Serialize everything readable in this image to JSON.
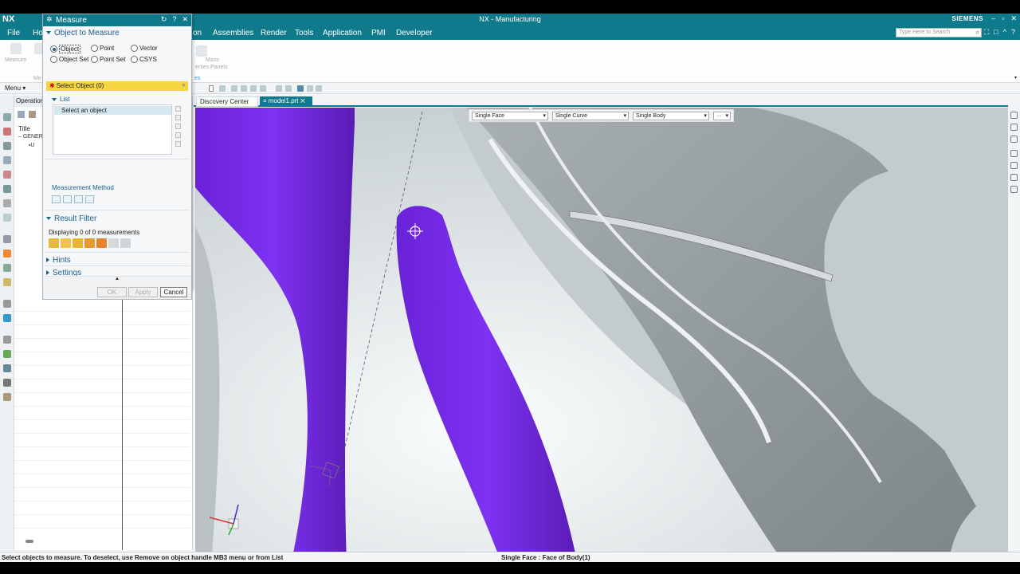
{
  "app": {
    "logo": "NX",
    "window_title": "NX - Manufacturing",
    "brand": "SIEMENS",
    "window_controls": [
      "–",
      "▫",
      "✕"
    ]
  },
  "menubar": {
    "items": [
      "File",
      "Ho",
      "on",
      "Assemblies",
      "Render",
      "Tools",
      "Application",
      "PMI",
      "Developer"
    ],
    "search_placeholder": "Type Here to Search",
    "right_controls": [
      "⛶",
      "□",
      "^",
      "?"
    ]
  },
  "ribbon": {
    "labels": [
      "Measure",
      "Me",
      "Mass",
      "erties Panels",
      "es"
    ]
  },
  "toolbar": {
    "menu_label": "Menu ▾"
  },
  "navigator": {
    "header": "Operation",
    "column_title": "Title",
    "root": "GENER",
    "child": "U"
  },
  "dialog": {
    "title": "Measure",
    "section_object": "Object to Measure",
    "radios": [
      {
        "label": "Object",
        "checked": true
      },
      {
        "label": "Point",
        "checked": false
      },
      {
        "label": "Vector",
        "checked": false
      },
      {
        "label": "Object Set",
        "checked": false
      },
      {
        "label": "Point Set",
        "checked": false
      },
      {
        "label": "CSYS",
        "checked": false
      }
    ],
    "select_object": "Select Object (0)",
    "list_label": "List",
    "list_item": "Select an object",
    "measurement_method": "Measurement Method",
    "section_result": "Result Filter",
    "displaying": "Displaying 0 of 0 measurements",
    "hints": "Hints",
    "settings": "Settings",
    "btn_ok": "OK",
    "btn_apply": "Apply",
    "btn_cancel": "Cancel"
  },
  "tabs": {
    "discovery": "Discovery Center",
    "model": "model1.prt"
  },
  "selection_filter": {
    "face": "Single Face",
    "curve": "Single Curve",
    "body": "Single Body",
    "more": "···"
  },
  "status": {
    "left": "Select objects to measure. To deselect, use Remove on object handle MB3 menu or from List",
    "right": "Single Face : Face of Body(1)"
  },
  "colors": {
    "accent": "#0f7a8c",
    "highlight": "#7b2ff0",
    "selection_yellow": "#f5d642"
  }
}
